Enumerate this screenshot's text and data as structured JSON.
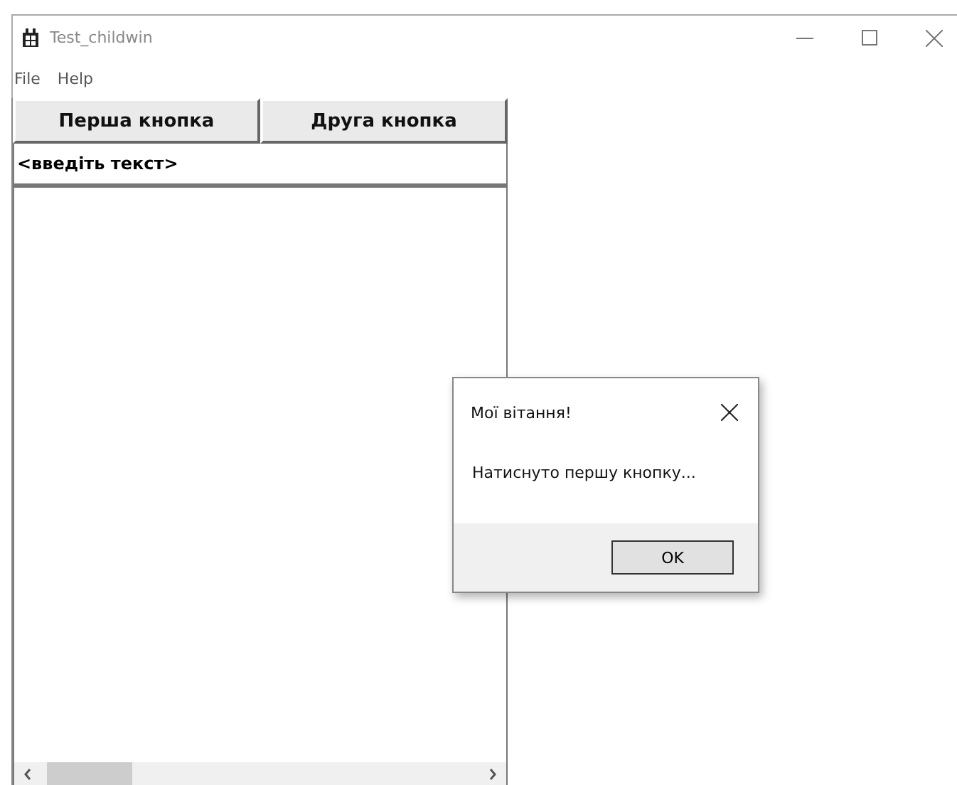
{
  "window": {
    "title": "Test_childwin"
  },
  "menu": [
    "File",
    "Help"
  ],
  "buttons": [
    "Перша кнопка",
    "Друга кнопка"
  ],
  "text_field": {
    "value": "<введіть текст>"
  },
  "dialog": {
    "title": "Мої вітання!",
    "message": "Натиснуто першу кнопку...",
    "button": "OK"
  }
}
